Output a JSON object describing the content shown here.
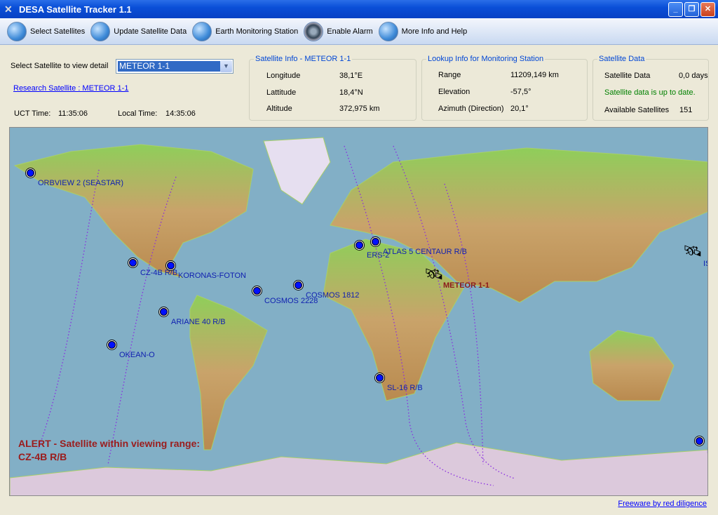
{
  "window": {
    "title": "DESA Satellite Tracker 1.1",
    "icon": "satellite-icon"
  },
  "toolbar": [
    {
      "label": "Select Satellites",
      "icon": "globe-icon"
    },
    {
      "label": "Update Satellite Data",
      "icon": "globe-folder-icon"
    },
    {
      "label": "Earth Monitoring Station",
      "icon": "monitor-icon"
    },
    {
      "label": "Enable Alarm",
      "icon": "speaker-icon"
    },
    {
      "label": "More Info and Help",
      "icon": "help-icon"
    }
  ],
  "selector": {
    "label": "Select Satellite to view detail",
    "value": "METEOR 1-1"
  },
  "research_link": "Research Satellite : METEOR 1-1",
  "time": {
    "uct_label": "UCT Time:",
    "uct": "11:35:06",
    "local_label": "Local Time:",
    "local": "14:35:06"
  },
  "sat_info": {
    "title": "Satellite Info - METEOR 1-1",
    "rows": [
      {
        "label": "Longitude",
        "value": "38,1°E"
      },
      {
        "label": "Lattitude",
        "value": "18,4°N"
      },
      {
        "label": "Altitude",
        "value": "372,975 km"
      }
    ]
  },
  "lookup": {
    "title": "Lookup Info for Monitoring Station",
    "rows": [
      {
        "label": "Range",
        "value": "11209,149 km"
      },
      {
        "label": "Elevation",
        "value": "-57,5°"
      },
      {
        "label": "Azimuth (Direction)",
        "value": "20,1°"
      }
    ]
  },
  "sat_data": {
    "title": "Satellite Data",
    "data_label": "Satellite Data",
    "data_value": "0,0 days",
    "status": "Satellite data is up to date.",
    "status_color": "#008000",
    "avail_label": "Available Satellites",
    "avail_value": "151"
  },
  "map": {
    "ocean_color": "#82afc6",
    "orbit_color": "#8a2be2",
    "satellites": [
      {
        "name": "ORBVIEW 2 (SEASTAR)"
      },
      {
        "name": "CZ-4B R/B"
      },
      {
        "name": "KORONAS-FOTON"
      },
      {
        "name": "COSMOS 2228"
      },
      {
        "name": "COSMOS 1812"
      },
      {
        "name": "ARIANE 40 R/B"
      },
      {
        "name": "OKEAN-O"
      },
      {
        "name": "ERS-2"
      },
      {
        "name": "ATLAS 5 CENTAUR R/B"
      },
      {
        "name": "SL-16 R/B"
      },
      {
        "name": "E"
      }
    ],
    "selected": "METEOR 1-1",
    "iss_label": "IS"
  },
  "alert": {
    "line1": "ALERT - Satellite within viewing range:",
    "line2": "CZ-4B R/B"
  },
  "footer_link": "Freeware by red diligence"
}
